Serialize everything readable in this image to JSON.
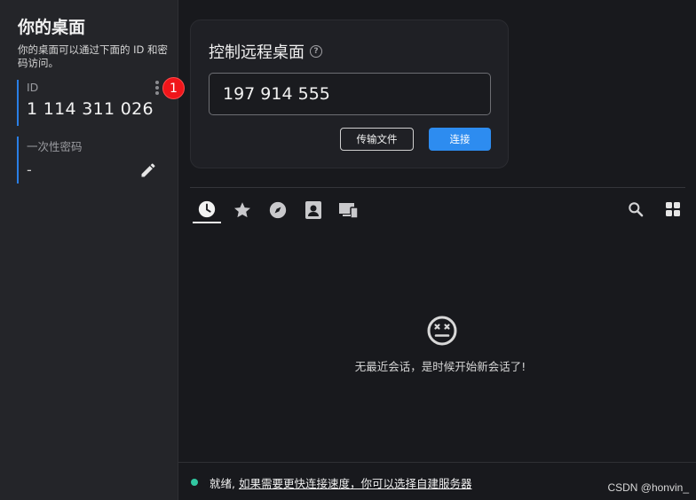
{
  "sidebar": {
    "title": "你的桌面",
    "description": "你的桌面可以通过下面的 ID 和密码访问。",
    "id_label": "ID",
    "id_value": "1 114 311 026",
    "badge": "1",
    "password_label": "一次性密码",
    "password_value": "-"
  },
  "remote": {
    "title": "控制远程桌面",
    "input_value": "197 914 555",
    "transfer_label": "传输文件",
    "connect_label": "连接"
  },
  "tabs": [
    {
      "name": "recent",
      "icon": "clock-icon",
      "active": true
    },
    {
      "name": "favorites",
      "icon": "star-icon"
    },
    {
      "name": "discovered",
      "icon": "compass-icon"
    },
    {
      "name": "address-book",
      "icon": "contact-icon"
    },
    {
      "name": "devices",
      "icon": "devices-icon"
    }
  ],
  "empty": {
    "icon": "sad-face-icon",
    "message": "无最近会话，是时候开始新会话了!"
  },
  "status": {
    "ready": "就绪,",
    "link_text": "如果需要更快连接速度，你可以选择自建服务器"
  },
  "watermark": "CSDN @honvin_",
  "colors": {
    "accent": "#2d8cf0",
    "badge": "#f0151a",
    "status_ok": "#31c7a1"
  }
}
